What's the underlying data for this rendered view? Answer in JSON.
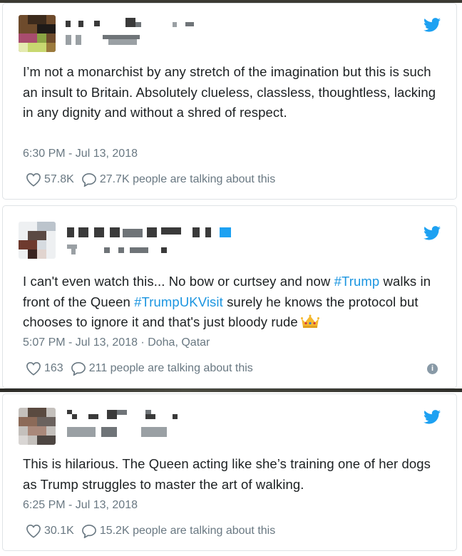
{
  "tweets": [
    {
      "text": "I’m not a monarchist by any stretch of the imagination but this is such an insult to Britain. Absolutely clueless, classless, thoughtless, lacking in any dignity and without a shred of respect.",
      "timestamp": "6:30 PM - Jul 13, 2018",
      "likes": "57.8K",
      "talking": "27.7K people are talking about this"
    },
    {
      "text_part1": "I can't even watch this... No bow or curtsey and now ",
      "hashtag1": "#Trump",
      "text_part2": " walks in front of the Queen ",
      "hashtag2": "#TrumpUKVisit",
      "text_part3": " surely he knows the protocol but chooses to ignore it and that's just bloody rude",
      "emoji": "crown-emoji",
      "timestamp": "5:07 PM - Jul 13, 2018",
      "location": " · Doha, Qatar",
      "likes": "163",
      "talking": "211 people are talking about this"
    },
    {
      "text": "This is hilarious. The Queen acting like she’s training one of her dogs as Trump struggles to master the art of walking.",
      "timestamp": "6:25 PM - Jul 13, 2018",
      "likes": "30.1K",
      "talking": "15.2K people are talking about this"
    }
  ],
  "icons": {
    "brand": "twitter-bird-icon",
    "like": "heart-icon",
    "reply": "speech-bubble-icon",
    "info": "info-icon"
  },
  "colors": {
    "twitter_blue": "#1da1f2",
    "hashtag": "#1b95e0",
    "meta_gray": "#697882"
  }
}
